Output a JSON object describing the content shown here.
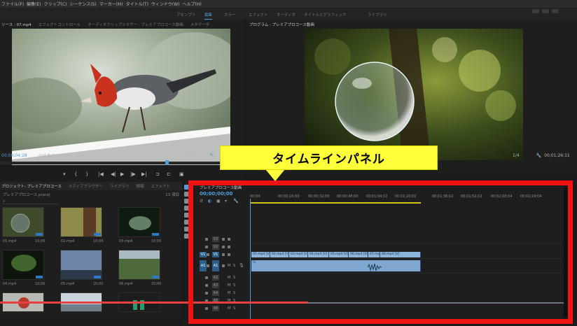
{
  "menu": [
    "ファイル(F)",
    "編集(E)",
    "クリップ(C)",
    "シーケンス(S)",
    "マーカー(M)",
    "タイトル(T)",
    "ウィンドウ(W)",
    "ヘルプ(H)"
  ],
  "workspaces": [
    {
      "label": "アセンブリ",
      "active": false
    },
    {
      "label": "編集",
      "active": true
    },
    {
      "label": "カラー",
      "active": false
    },
    {
      "label": "エフェクト",
      "active": false
    },
    {
      "label": "オーディオ",
      "active": false
    },
    {
      "label": "タイトルとグラフィック",
      "active": false
    },
    {
      "label": "ライブラリ",
      "active": false
    }
  ],
  "source_monitor": {
    "tabs": [
      "ソース : 07.mp4",
      "エフェクトコントロール",
      "オーディオクリップミキサー : プレミアプロコース動画",
      "メタデータ"
    ],
    "timecode": "00;00;04;28",
    "fit": "全体表示",
    "resolution": "1/2"
  },
  "program_monitor": {
    "tab": "プログラム : プレミアプロコース動画",
    "resolution": "1/4",
    "timecode": "00;01;26;11"
  },
  "callout": {
    "text": "タイムラインパネル"
  },
  "project": {
    "tabs": [
      "プロジェクト: プレミアプロコース",
      "メディアブラウザー",
      "ライブラリ",
      "情報",
      "エフェクト"
    ],
    "file": "プレミアプロコース.prproj",
    "count": "13 項目",
    "items": [
      {
        "name": "01.mp4",
        "duration": "10;00"
      },
      {
        "name": "02.mp4",
        "duration": "10;00"
      },
      {
        "name": "03.mp4",
        "duration": "10;00"
      },
      {
        "name": "04.mp4",
        "duration": "10;00"
      },
      {
        "name": "05.mp4",
        "duration": "10;00"
      },
      {
        "name": "06.mp4",
        "duration": "10;00"
      },
      {
        "name": "",
        "duration": ""
      },
      {
        "name": "",
        "duration": ""
      },
      {
        "name": "",
        "duration": ""
      }
    ]
  },
  "timeline": {
    "tab": "プレミアプロコース動画",
    "timecode": "00;00;00;00",
    "ruler": [
      "00;00",
      "00;00;16;00",
      "00;00;32;00",
      "00;00;48;00",
      "00;01;04;02",
      "00;01;20;02",
      "00;01;36;02",
      "00;01;52;02",
      "00;02;08;04",
      "00;02;24;04"
    ],
    "video_tracks": [
      "V3",
      "V2",
      "V1"
    ],
    "audio_tracks": [
      "A1",
      "A2",
      "A3",
      "A4",
      "A5",
      "A6"
    ],
    "v1_clips": [
      "01.mp4 [V]",
      "02.mp4 [V]",
      "03.mp4 [V]",
      "04.mp4 [V]",
      "05.mp4 [V]",
      "06.mp4 [V]",
      "07.mp4 [V]",
      "08.mp4 [V]"
    ],
    "a1_label": "fx"
  },
  "colors": {
    "accent": "#4f9ed8",
    "highlight_frame": "#f31212",
    "callout_bg": "#ffff3a",
    "work_area": "#d6c21a"
  }
}
